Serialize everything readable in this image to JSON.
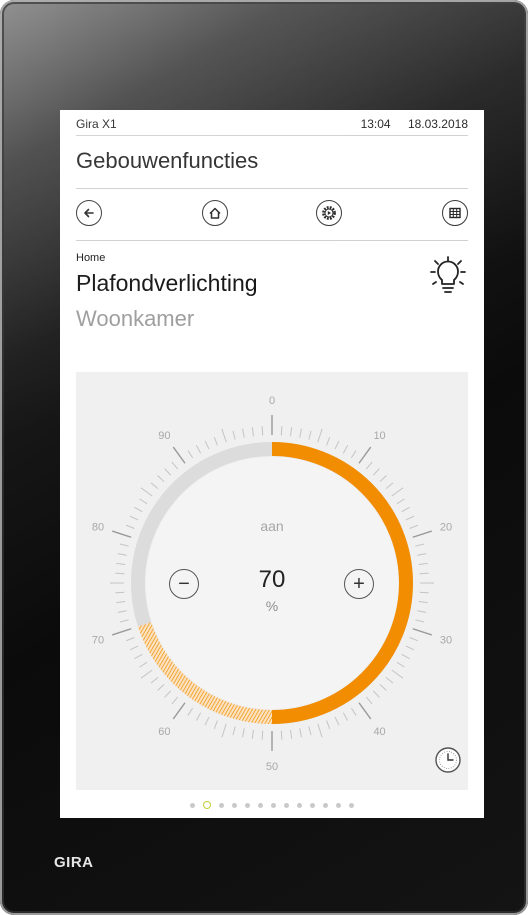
{
  "status_bar": {
    "device": "Gira X1",
    "time": "13:04",
    "date": "18.03.2018"
  },
  "page": {
    "title": "Gebouwenfuncties"
  },
  "nav": {
    "back_icon": "arrow-left-icon",
    "home_icon": "home-icon",
    "scene_icon": "gear-play-icon",
    "grid_icon": "grid-icon"
  },
  "function": {
    "breadcrumb": "Home",
    "name": "Plafondverlichting",
    "room": "Woonkamer",
    "icon": "lightbulb-icon"
  },
  "dimmer": {
    "state": "aan",
    "value": "70",
    "unit": "%",
    "level_percent": 70,
    "scale_labels": [
      "0",
      "10",
      "20",
      "30",
      "40",
      "50",
      "60",
      "70",
      "80",
      "90"
    ],
    "accent_color": "#f28c00",
    "track_color": "#dcdcdc",
    "minus_label": "−",
    "plus_label": "+"
  },
  "pager": {
    "count": 13,
    "active_index": 1,
    "active_color": "#c4cf3a"
  },
  "brand": "GIRA"
}
